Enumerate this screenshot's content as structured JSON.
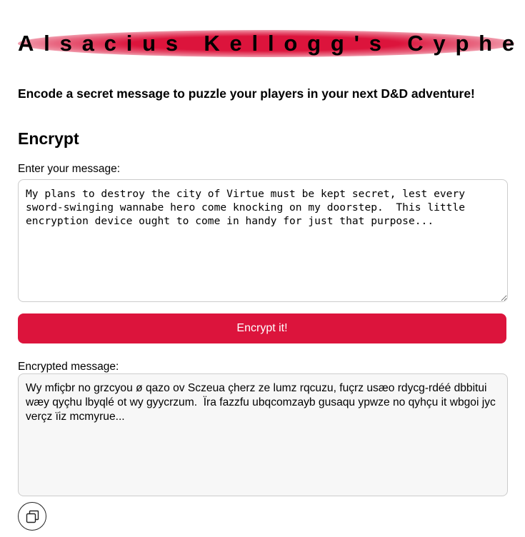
{
  "header": {
    "title": "Alsacius Kellogg's Cypher",
    "subtitle": "Encode a secret message to puzzle your players in your next D&D adventure!"
  },
  "encrypt": {
    "heading": "Encrypt",
    "message_label": "Enter your message:",
    "message_value": "My plans to destroy the city of Virtue must be kept secret, lest every sword-swinging wannabe hero come knocking on my doorstep.  This little encryption device ought to come in handy for just that purpose...",
    "button_label": "Encrypt it!",
    "encrypted_label": "Encrypted message:",
    "encrypted_value": "Wy mfiçbr no grzcyou ø qazo ov Sczeua çherz ze lumz rqcuzu, fuçrz usæo rdycg-rdéé dbbitui wæy qyçhu lbyqlé ot wy gyycrzum.  Ïra fazzfu ubqcomzayb gusaqu ypwze no qyhçu it wbgoi jyc verçz ïiz mcmyrue..."
  },
  "icons": {
    "copy": "copy-icon"
  },
  "colors": {
    "accent": "#dc143c",
    "output_background": "#f7f7f7",
    "border": "#cccccc"
  }
}
